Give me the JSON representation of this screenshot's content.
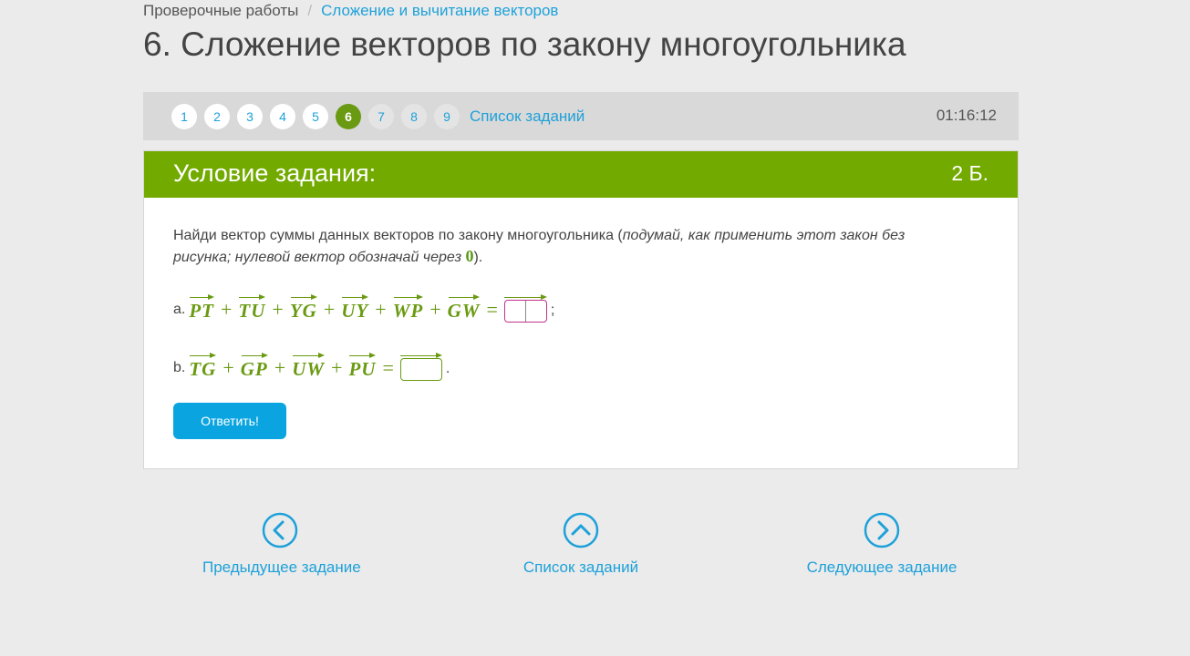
{
  "breadcrumb": {
    "root": "Проверочные работы",
    "separator": "/",
    "current": "Сложение и вычитание векторов"
  },
  "page_title": "6. Сложение векторов по закону многоугольника",
  "task_nav": {
    "pages": [
      "1",
      "2",
      "3",
      "4",
      "5",
      "6",
      "7",
      "8",
      "9"
    ],
    "current_page": "6",
    "list_link": "Список заданий",
    "timer": "01:16:12"
  },
  "card": {
    "title": "Условие задания:",
    "points": "2 Б.",
    "statement_main": "Найди вектор суммы данных векторов по закону многоугольника (",
    "statement_italic": "подумай, как применить этот закон без рисунка; нулевой вектор обозначай через ",
    "zero_symbol": "0",
    "statement_end": ").",
    "task_a": {
      "label": "a.",
      "vectors": [
        "PT",
        "TU",
        "YG",
        "UY",
        "WP",
        "GW"
      ],
      "plus": "+",
      "equals": "=",
      "end_punct": ";"
    },
    "task_b": {
      "label": "b.",
      "vectors": [
        "TG",
        "GP",
        "UW",
        "PU"
      ],
      "plus": "+",
      "equals": "=",
      "end_punct": "."
    },
    "answer_button": "Ответить!"
  },
  "bottom_nav": {
    "prev": "Предыдущее задание",
    "list": "Список заданий",
    "next": "Следующее задание"
  },
  "colors": {
    "accent_blue": "#1ea1d9",
    "header_green": "#72aa00",
    "math_green": "#6a9a12",
    "button_blue": "#0aa5e0"
  }
}
